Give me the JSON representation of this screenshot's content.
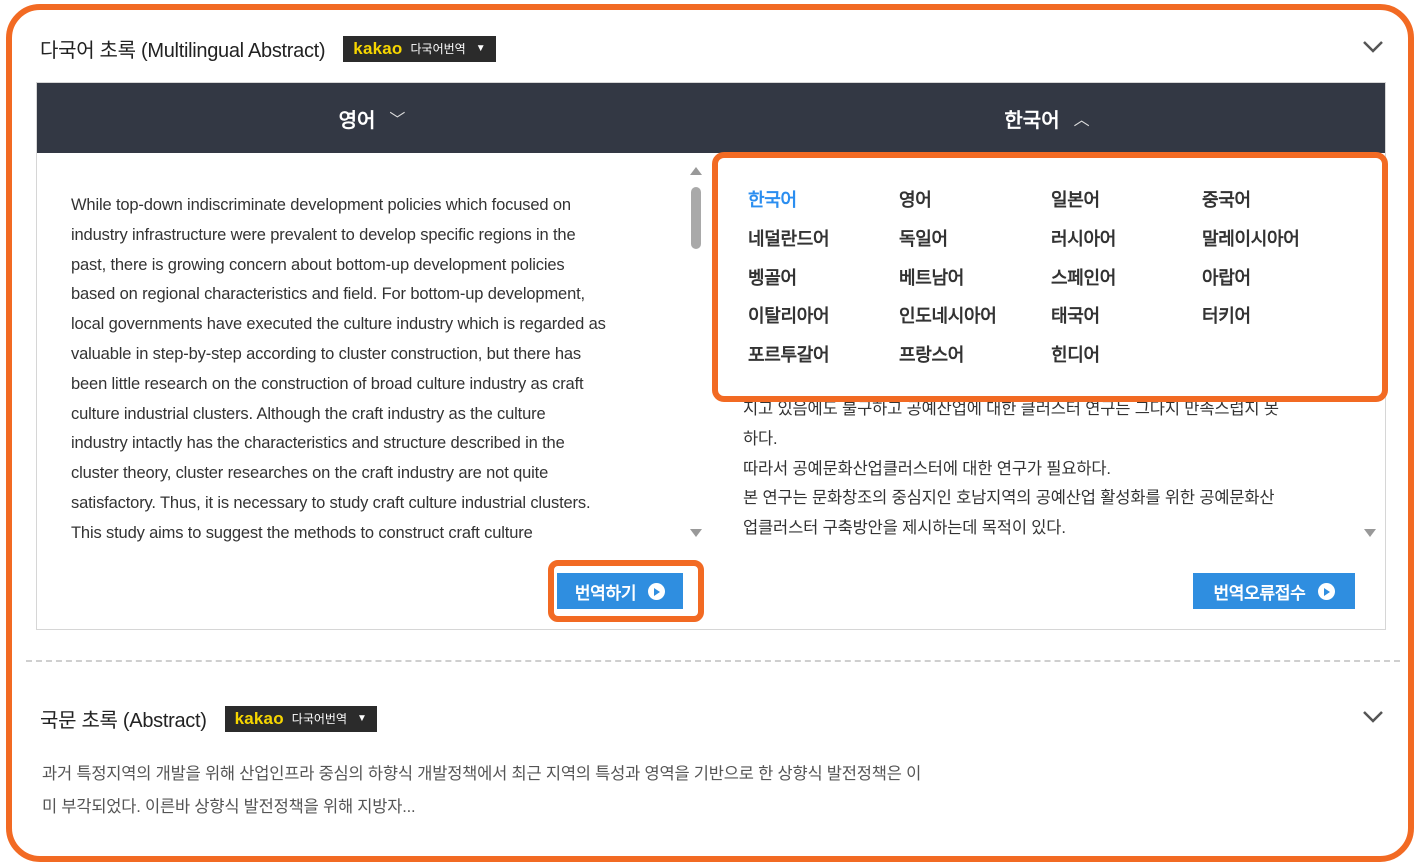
{
  "multilingual_section": {
    "title": "다국어 초록 (Multilingual Abstract)",
    "kakao_logo": "kakao",
    "kakao_label": "다국어번역",
    "source_lang_tab": "영어",
    "target_lang_tab": "한국어",
    "source_text": [
      "While top-down indiscriminate development policies which focused on",
      "industry infrastructure were prevalent to develop specific regions in the",
      "past, there is growing concern about bottom-up development policies",
      "based on regional characteristics and field. For bottom-up development,",
      "local governments have executed the culture industry which is regarded as",
      "valuable in step-by-step according to cluster construction, but there has",
      "been little research on the construction of broad culture industry as craft",
      "culture industrial clusters. Although the craft industry as the culture",
      "industry intactly has the characteristics and structure described in the",
      "cluster theory, cluster researches on the craft industry are not quite",
      "satisfactory. Thus, it is necessary to study craft culture industrial clusters.",
      "This study aims to suggest the methods to construct craft culture"
    ],
    "target_text": [
      "지고 있음에도 불구하고 공예산업에 대한 클러스터 연구는 그다지 만족스럽지 못",
      "하다.",
      "따라서 공예문화산업클러스터에 대한 연구가 필요하다.",
      "본 연구는 문화창조의 중심지인 호남지역의 공예산업 활성화를 위한 공예문화산",
      "업클러스터 구축방안을 제시하는데 목적이 있다."
    ],
    "translate_button": "번역하기",
    "report_error_button": "번역오류접수",
    "language_menu": {
      "selected": "한국어",
      "options": [
        "한국어",
        "영어",
        "일본어",
        "중국어",
        "네덜란드어",
        "독일어",
        "러시아어",
        "말레이시아어",
        "벵골어",
        "베트남어",
        "스페인어",
        "아랍어",
        "이탈리아어",
        "인도네시아어",
        "태국어",
        "터키어",
        "포르투갈어",
        "프랑스어",
        "힌디어"
      ]
    }
  },
  "abstract_section": {
    "title": "국문 초록 (Abstract)",
    "kakao_logo": "kakao",
    "kakao_label": "다국어번역",
    "preview_lines": [
      "과거 특정지역의 개발을 위해 산업인프라 중심의 하향식 개발정책에서 최근 지역의 특성과 영역을 기반으로 한 상향식 발전정책은 이",
      "미 부각되었다. 이른바 상향식 발전정책을 위해 지방자..."
    ]
  },
  "colors": {
    "highlight": "#f26a23",
    "header_bar": "#333844",
    "button_blue": "#2f8ee0",
    "active_language": "#2b8ef0",
    "kakao_yellow": "#f7d600"
  }
}
